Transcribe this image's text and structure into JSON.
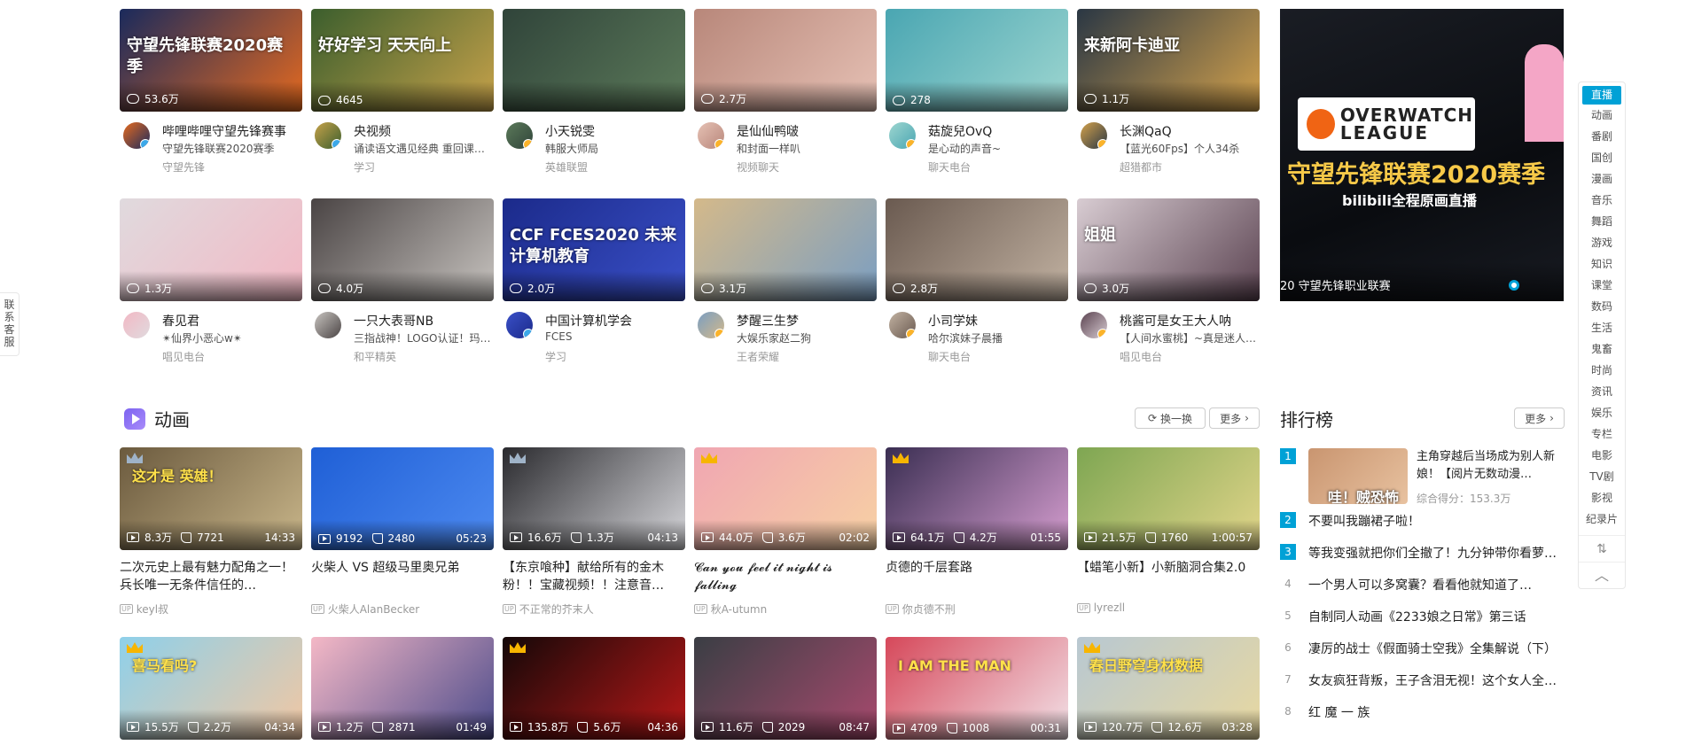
{
  "live": [
    {
      "title_overlay": "守望先锋联赛2020赛季",
      "count": "53.6万",
      "name": "哔哩哔哩守望先锋赛事",
      "title": "守望先锋联赛2020赛季",
      "area": "守望先锋",
      "colors": [
        "#1a2a5c",
        "#e66a1f"
      ],
      "badge": "blue"
    },
    {
      "title_overlay": "好好学习 天天向上",
      "count": "4645",
      "name": "央视频",
      "title": "诵读语文遇见经典 重回课…",
      "area": "学习",
      "colors": [
        "#3b5e2d",
        "#c7a24a"
      ],
      "badge": "blue"
    },
    {
      "title_overlay": "",
      "count": "",
      "name": "小天锐雯",
      "title": "韩服大师局",
      "area": "英雄联盟",
      "colors": [
        "#30443a",
        "#5c7a5a"
      ],
      "badge": "yellow"
    },
    {
      "title_overlay": "",
      "count": "2.7万",
      "name": "是仙仙鸭啵",
      "title": "和封面一样叭",
      "area": "视频聊天",
      "colors": [
        "#b8877a",
        "#e6c1b5"
      ],
      "badge": "yellow"
    },
    {
      "title_overlay": "",
      "count": "278",
      "name": "菇旋兒OvQ",
      "title": "是心动的声音~",
      "area": "聊天电台",
      "colors": [
        "#4aa6b2",
        "#9ed6d0"
      ],
      "badge": "yellow"
    },
    {
      "title_overlay": "来新阿卡迪亚",
      "count": "1.1万",
      "name": "长渊QaQ",
      "title": "【蓝光60Fps】个人34杀",
      "area": "超猎都市",
      "colors": [
        "#2a3744",
        "#d4a24c"
      ],
      "badge": "yellow"
    },
    {
      "title_overlay": "",
      "count": "1.3万",
      "name": "春见君",
      "title": "✴仙界小恶心w✴",
      "area": "唱见电台",
      "colors": [
        "#e0dade",
        "#f2b8c4"
      ],
      "badge": ""
    },
    {
      "title_overlay": "",
      "count": "4.0万",
      "name": "一只大表哥NB",
      "title": "三指战神！LOGO认证！玛…",
      "area": "和平精英",
      "colors": [
        "#4a4444",
        "#c8c4c0"
      ],
      "badge": ""
    },
    {
      "title_overlay": "CCF FCES2020 未来计算机教育",
      "count": "2.0万",
      "name": "中国计算机学会",
      "title": "FCES",
      "area": "学习",
      "colors": [
        "#1b2a8a",
        "#3a50c8"
      ],
      "badge": "blue"
    },
    {
      "title_overlay": "",
      "count": "3.1万",
      "name": "梦醒三生梦",
      "title": "大娱乐家赵二狗",
      "area": "王者荣耀",
      "colors": [
        "#d4b98a",
        "#7a9ec2"
      ],
      "badge": "yellow"
    },
    {
      "title_overlay": "",
      "count": "2.8万",
      "name": "小司学妹",
      "title": "哈尔滨妹子晨播",
      "area": "聊天电台",
      "colors": [
        "#6a5a50",
        "#c2b2a2"
      ],
      "badge": "yellow"
    },
    {
      "title_overlay": "姐姐",
      "count": "3.0万",
      "name": "桃酱可是女王大人呐",
      "title": "【人间水蜜桃】~真是迷人…",
      "area": "唱见电台",
      "colors": [
        "#d8ccd2",
        "#5a4250"
      ],
      "badge": "yellow"
    }
  ],
  "banner": {
    "logo_line1": "OVERWATCH",
    "logo_line2": "LEAGUE",
    "headline": "守望先锋联赛2020赛季",
    "sub": "bilibili全程原画直播",
    "caption": "20 守望先锋职业联赛"
  },
  "section": {
    "title": "动画",
    "swap_label": "换一换",
    "more_label": "更多"
  },
  "videos": [
    {
      "views": "8.3万",
      "likes": "7721",
      "duration": "14:33",
      "title": "二次元史上最有魅力配角之一！兵长唯一无条件信任的…",
      "up": "keyl叔",
      "crown": "silver",
      "colors": [
        "#6b5a3e",
        "#c9b68a"
      ],
      "overlay": "这才是 英雄！"
    },
    {
      "views": "9192",
      "likes": "2480",
      "duration": "05:23",
      "title": "火柴人 VS 超级马里奥兄弟",
      "up": "火柴人AlanBecker",
      "crown": "",
      "colors": [
        "#1f5fd6",
        "#4d8af0"
      ],
      "overlay": ""
    },
    {
      "views": "16.6万",
      "likes": "1.3万",
      "duration": "04:13",
      "title": "【东京喰种】献给所有的金木粉！！宝藏视频！！注意音…",
      "up": "不正常的芥末人",
      "crown": "silver",
      "colors": [
        "#2a2a2e",
        "#d8d8dc"
      ],
      "overlay": ""
    },
    {
      "views": "44.0万",
      "likes": "3.6万",
      "duration": "02:02",
      "title": "𝓒𝓪𝓷 𝔂𝓸𝓾 𝓯𝓮𝓮𝓵 𝓲𝓽 𝓷𝓲𝓰𝓱𝓽 𝓲𝓼 𝓯𝓪𝓵𝓵𝓲𝓷𝓰",
      "up": "秋A-utumn",
      "crown": "gold",
      "colors": [
        "#f0a6b2",
        "#f7d1a4"
      ],
      "overlay": ""
    },
    {
      "views": "64.1万",
      "likes": "4.2万",
      "duration": "01:55",
      "title": "贞德的千层套路",
      "up": "你贞德不刑",
      "crown": "gold",
      "colors": [
        "#3a2e52",
        "#d69ed0"
      ],
      "overlay": ""
    },
    {
      "views": "21.5万",
      "likes": "1760",
      "duration": "1:00:57",
      "title": "【蜡笔小新】小新脑洞合集2.0",
      "up": "lyrezll",
      "crown": "",
      "colors": [
        "#7ea652",
        "#e2d58a"
      ],
      "overlay": ""
    },
    {
      "views": "15.5万",
      "likes": "2.2万",
      "duration": "04:34",
      "title": "",
      "up": "",
      "crown": "gold",
      "colors": [
        "#8ed0ea",
        "#f2c7a2"
      ],
      "overlay": "喜马看吗?"
    },
    {
      "views": "1.2万",
      "likes": "2871",
      "duration": "01:49",
      "title": "",
      "up": "",
      "crown": "",
      "colors": [
        "#f4b8c6",
        "#4a4a8a"
      ],
      "overlay": ""
    },
    {
      "views": "135.8万",
      "likes": "5.6万",
      "duration": "04:36",
      "title": "",
      "up": "",
      "crown": "gold",
      "colors": [
        "#140808",
        "#b81818"
      ],
      "overlay": ""
    },
    {
      "views": "11.6万",
      "likes": "2029",
      "duration": "08:47",
      "title": "",
      "up": "",
      "crown": "",
      "colors": [
        "#3a3e44",
        "#a84a6e"
      ],
      "overlay": ""
    },
    {
      "views": "4709",
      "likes": "1008",
      "duration": "00:31",
      "title": "",
      "up": "",
      "crown": "",
      "colors": [
        "#d6485a",
        "#f2e2e8"
      ],
      "overlay": "I AM THE MAN"
    },
    {
      "views": "120.7万",
      "likes": "12.6万",
      "duration": "03:28",
      "title": "",
      "up": "",
      "crown": "gold",
      "colors": [
        "#b8c8d2",
        "#e8d8a0"
      ],
      "overlay": "春日野穹身材数据"
    }
  ],
  "ranking": {
    "title": "排行榜",
    "more_label": "更多",
    "top": {
      "title": "主角穿越后当场成为别人新娘！【阅片无数动漫…",
      "score": "综合得分：153.3万",
      "thumb_text": "哇！贼恐怖"
    },
    "items": [
      {
        "rank": "1",
        "title": ""
      },
      {
        "rank": "2",
        "title": "不要叫我蹦裙子啦！"
      },
      {
        "rank": "3",
        "title": "等我变强就把你们全撤了！九分钟带你看萝…"
      },
      {
        "rank": "4",
        "title": "一个男人可以多窝囊？看看他就知道了…"
      },
      {
        "rank": "5",
        "title": "自制同人动画《2233娘之日常》第三话"
      },
      {
        "rank": "6",
        "title": "凄厉的战士《假面骑士空我》全集解说（下）"
      },
      {
        "rank": "7",
        "title": "女友疯狂背叛，王子含泪无视！这个女人全…"
      },
      {
        "rank": "8",
        "title": "红 魔 一 族"
      }
    ]
  },
  "side_nav": [
    "直播",
    "动画",
    "番剧",
    "国创",
    "漫画",
    "音乐",
    "舞蹈",
    "游戏",
    "知识",
    "课堂",
    "数码",
    "生活",
    "鬼畜",
    "时尚",
    "资讯",
    "娱乐",
    "专栏",
    "电影",
    "TV剧",
    "影视",
    "纪录片"
  ],
  "contact": "联系客服",
  "accent": "#00a1d6"
}
